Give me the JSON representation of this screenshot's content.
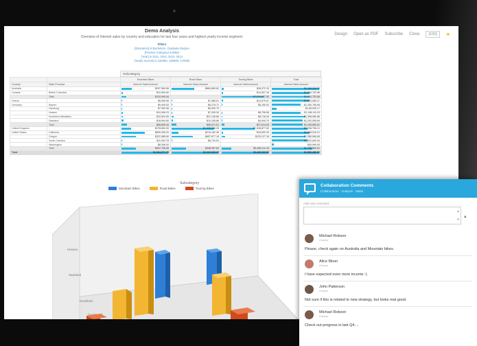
{
  "toolbar": {
    "actions": [
      "Design",
      "Open as PDF",
      "Subscribe",
      "Close"
    ],
    "zoom": "[100]"
  },
  "report": {
    "title": "Demo Analysis",
    "subtitle": "Overview of Internet sales by country and education for last four years and highest yearly income segment.",
    "filter_heading": "Filters",
    "filters": [
      "[Education] is Bachelors, Graduate Degree",
      "[Product Category] is Bikes",
      "[Year] is 2011, 2012, 2013, 2014",
      "[Yearly Income] is 130000, 150000, 170000"
    ]
  },
  "table": {
    "subcategory_header": "Subcategory",
    "dim_headers": [
      "Country",
      "State Province"
    ],
    "group_headers": [
      "Mountain Bikes",
      "Road Bikes",
      "Touring Bikes",
      "Total"
    ],
    "measure_header": "Internet Sales Amount",
    "rows": [
      {
        "country": "Australia",
        "state": "",
        "values": [
          "$297,965.56",
          "$660,869.62",
          "$18,973.15",
          "$1,988,906.29"
        ],
        "bars": [
          0.22,
          0.48,
          0.05,
          1.0
        ],
        "kind": "row"
      },
      {
        "country": "Canada",
        "state": "British Columbia",
        "values": [
          "$10,994.50",
          "",
          "$14,907.18",
          "$1,594,752.86"
        ],
        "bars": [
          0.03,
          0,
          0.03,
          0.8
        ],
        "kind": "row"
      },
      {
        "country": "",
        "state": "Total",
        "values": [
          "$120,990.54",
          "",
          "$1,510,677.50",
          "$1,594,752.86"
        ],
        "bars": [
          0.1,
          0,
          0.9,
          0.8
        ],
        "kind": "total"
      },
      {
        "country": "France",
        "state": "",
        "values": [
          "$5,595.98",
          "$7,568.51",
          "$14,579.67",
          "$1,623,585.27"
        ],
        "bars": [
          0.02,
          0.02,
          0.03,
          0.8
        ],
        "kind": "row"
      },
      {
        "country": "Germany",
        "state": "Bayern",
        "values": [
          "$9,405.53",
          "$5,278.71",
          "$5,150.02",
          "$1,250,785.65"
        ],
        "bars": [
          0.02,
          0.02,
          0.02,
          0.6
        ],
        "kind": "row"
      },
      {
        "country": "",
        "state": "Hamburg",
        "values": [
          "$7,993.98",
          "$5,993.79",
          "",
          "$1,85,999.17"
        ],
        "bars": [
          0.02,
          0.02,
          0,
          0.1
        ],
        "kind": "row"
      },
      {
        "country": "",
        "state": "Hessen",
        "values": [
          "$10,996.23",
          "$7,905.30",
          "$8,796.58",
          "$1,198,119.23"
        ],
        "bars": [
          0.03,
          0.02,
          0.02,
          0.6
        ],
        "kind": "row"
      },
      {
        "country": "",
        "state": "Nordrhein-Westfalen",
        "values": [
          "$10,504.95",
          "$21,136.85",
          "$8,718.28",
          "$1,398,080.86"
        ],
        "bars": [
          0.03,
          0.05,
          0.02,
          0.7
        ],
        "kind": "row"
      },
      {
        "country": "",
        "state": "Saarland",
        "values": [
          "$18,994.80",
          "$10,155.86",
          "$4,949.75",
          "$1,292,955.69"
        ],
        "bars": [
          0.05,
          0.03,
          0.02,
          0.65
        ],
        "kind": "row"
      },
      {
        "country": "",
        "state": "Total",
        "values": [
          "$58,895.49",
          "$50,571.51",
          "$27,614.63",
          "$1,295,983.51"
        ],
        "bars": [
          0.12,
          0.1,
          0.06,
          0.65
        ],
        "kind": "total"
      },
      {
        "country": "United Kingdom",
        "state": "",
        "values": [
          "$278,894.39",
          "$1,935,526.28",
          "$1,528,877.83",
          "$1,526,796.21"
        ],
        "bars": [
          0.2,
          0.9,
          0.7,
          0.75
        ],
        "kind": "row"
      },
      {
        "country": "United States",
        "state": "California",
        "values": [
          "$699,495.20",
          "$216,162.35",
          "$15,692.39",
          "$1,628,916.21"
        ],
        "bars": [
          0.5,
          0.15,
          0.03,
          0.8
        ],
        "kind": "row"
      },
      {
        "country": "",
        "state": "Oregon",
        "values": [
          "$322,985.60",
          "$657,677.18",
          "$120,127.18",
          "$1,380,984.65"
        ],
        "bars": [
          0.3,
          0.45,
          0.08,
          0.7
        ],
        "kind": "row"
      },
      {
        "country": "",
        "state": "South Carolina",
        "values": [
          "$11,992.78",
          "$6,704.52",
          "",
          "$1,532,600.54"
        ],
        "bars": [
          0.02,
          0.02,
          0,
          0.75
        ],
        "kind": "row"
      },
      {
        "country": "",
        "state": "Washington",
        "values": [
          "$8,396.00",
          "",
          "",
          "$40,999.00"
        ],
        "bars": [
          0.02,
          0,
          0,
          0.05
        ],
        "kind": "row"
      },
      {
        "country": "",
        "state": "Total",
        "values": [
          "$357,796.55",
          "$348,957.82",
          "$3,455,211.16",
          "$1,785,660.81"
        ],
        "bars": [
          0.3,
          0.3,
          0.2,
          0.85
        ],
        "kind": "total"
      },
      {
        "country": "Total",
        "state": "",
        "values": [
          "$1,804,371.78",
          "$2,626,669.25",
          "$3,436,669.53",
          "$1,886,480.92"
        ],
        "bars": [
          1.0,
          1.0,
          1.0,
          1.0
        ],
        "kind": "grand"
      }
    ]
  },
  "chart": {
    "title": "Subcategory",
    "legend": [
      {
        "name": "Mountain Bikes",
        "color": "#2f7fd6"
      },
      {
        "name": "Road Bikes",
        "color": "#f2b632"
      },
      {
        "name": "Touring Bikes",
        "color": "#d04a1c"
      }
    ],
    "axis_labels": [
      "Hessen",
      "Saarland",
      "Nordrhein",
      "Quarter all"
    ]
  },
  "collab": {
    "title": "Collaboration Comments",
    "subtitle": "Collaboration · Analysis · Sales",
    "add_label": "Add new comment",
    "comments": [
      {
        "name": "Michael Robson",
        "time": "4 hours",
        "text": "Please, check again on Australia and Mountain bikes.",
        "avatar": "#7a5a4a"
      },
      {
        "name": "Alice Moon",
        "time": "4 hours",
        "text": "I have expected even more income :).",
        "avatar": "#c47a6a"
      },
      {
        "name": "John Patterson",
        "time": "4 hours",
        "text": "Not sure if this is related to new strategy, but looks real good.",
        "avatar": "#6e5646"
      },
      {
        "name": "Michael Robson",
        "time": "4 hours",
        "text": "Check out progress in last Q4....",
        "avatar": "#7a5a4a"
      }
    ]
  }
}
